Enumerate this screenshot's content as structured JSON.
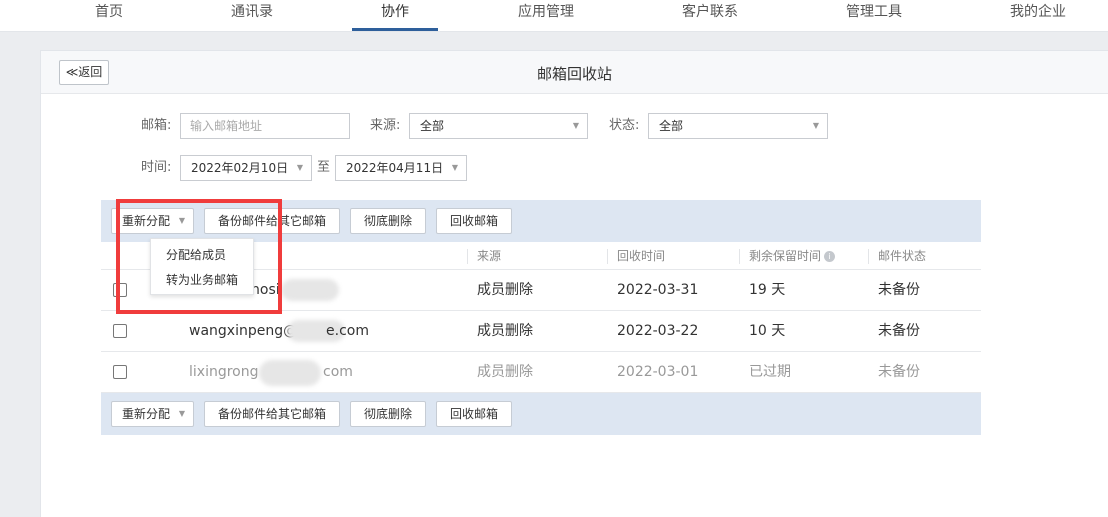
{
  "nav": {
    "items": [
      {
        "label": "首页"
      },
      {
        "label": "通讯录"
      },
      {
        "label": "协作"
      },
      {
        "label": "应用管理"
      },
      {
        "label": "客户联系"
      },
      {
        "label": "管理工具"
      },
      {
        "label": "我的企业"
      }
    ],
    "active": "协作"
  },
  "header": {
    "back_label": "≪返回",
    "title": "邮箱回收站"
  },
  "filters": {
    "mailbox_label": "邮箱:",
    "mailbox_placeholder": "输入邮箱地址",
    "source_label": "来源:",
    "source_value": "全部",
    "status_label": "状态:",
    "status_value": "全部",
    "time_label": "时间:",
    "date_from": "2022年02月10日",
    "date_sep": "至",
    "date_to": "2022年04月11日"
  },
  "toolbar": {
    "reassign": "重新分配",
    "backup": "备份邮件给其它邮箱",
    "delete": "彻底删除",
    "recover": "回收邮箱"
  },
  "dropdown": {
    "items": [
      "分配给成员",
      "转为业务邮箱"
    ]
  },
  "table": {
    "columns": [
      "来源",
      "回收时间",
      "剩余保留时间",
      "邮件状态"
    ],
    "rows": [
      {
        "email": "nosi",
        "source": "成员删除",
        "time": "2022-03-31",
        "remaining": "19 天",
        "status": "未备份"
      },
      {
        "email_prefix": "wangxinpeng@",
        "email_suffix": "e.com",
        "source": "成员删除",
        "time": "2022-03-22",
        "remaining": "10 天",
        "status": "未备份"
      },
      {
        "email_prefix": "lixingrong",
        "email_suffix": "com",
        "source": "成员删除",
        "time": "2022-03-01",
        "remaining": "已过期",
        "status": "未备份"
      }
    ]
  },
  "colors": {
    "accent": "#2e5f9b",
    "toolbar_bg": "#dde6f2",
    "highlight": "#f03c3c"
  }
}
